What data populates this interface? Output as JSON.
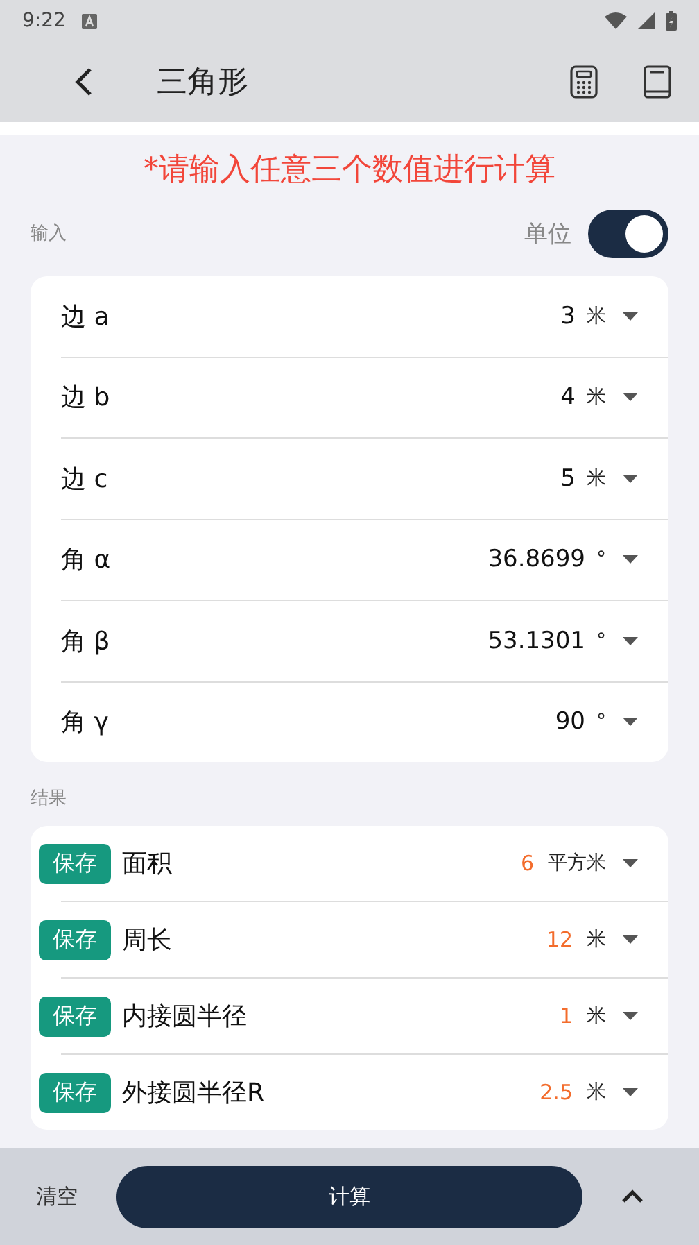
{
  "status_bar": {
    "time": "9:22"
  },
  "app_bar": {
    "title": "三角形"
  },
  "notice": "*请输入任意三个数值进行计算",
  "input_section": {
    "label": "输入",
    "unit_label": "单位",
    "unit_toggle": {
      "on": true
    }
  },
  "inputs": [
    {
      "label": "边 a",
      "value": "3",
      "unit": "米"
    },
    {
      "label": "边 b",
      "value": "4",
      "unit": "米"
    },
    {
      "label": "边 c",
      "value": "5",
      "unit": "米"
    },
    {
      "label": "角 α",
      "value": "36.8699",
      "unit": "°"
    },
    {
      "label": "角 β",
      "value": "53.1301",
      "unit": "°"
    },
    {
      "label": "角 γ",
      "value": "90",
      "unit": "°"
    }
  ],
  "results_section": {
    "label": "结果"
  },
  "results": [
    {
      "save": "保存",
      "label": "面积",
      "value": "6",
      "unit": "平方米"
    },
    {
      "save": "保存",
      "label": "周长",
      "value": "12",
      "unit": "米"
    },
    {
      "save": "保存",
      "label": "内接圆半径",
      "value": "1",
      "unit": "米"
    },
    {
      "save": "保存",
      "label": "外接圆半径R",
      "value": "2.5",
      "unit": "米"
    }
  ],
  "bottom_bar": {
    "clear": "清空",
    "calculate": "计算"
  }
}
